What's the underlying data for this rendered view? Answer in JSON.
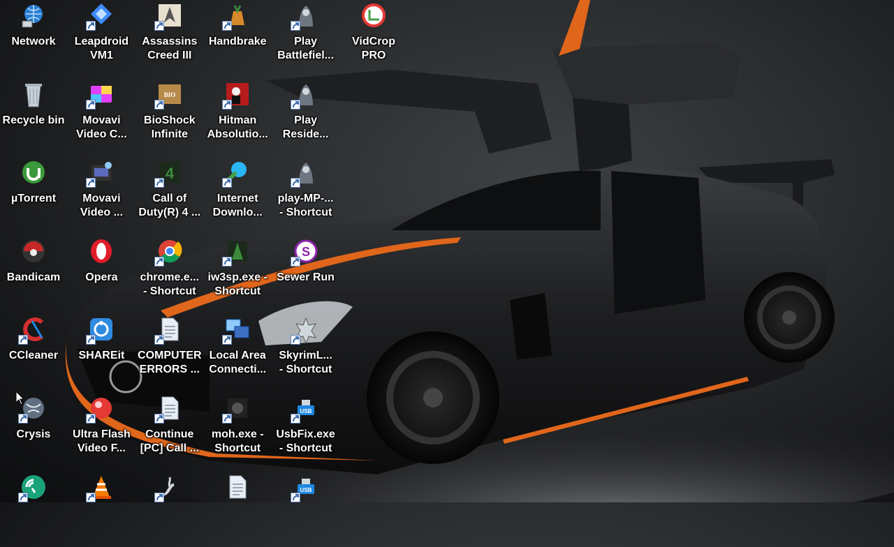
{
  "desktop": {
    "icons": [
      {
        "label": "Network",
        "icon": "network-icon",
        "shortcut": false,
        "color": "#2a7fd4"
      },
      {
        "label": "Recycle bin",
        "icon": "recycle-bin-icon",
        "shortcut": false,
        "color": "#9aa4ad"
      },
      {
        "label": "µTorrent",
        "icon": "utorrent-icon",
        "shortcut": false,
        "color": "#3a9a3a"
      },
      {
        "label": "Bandicam",
        "icon": "bandicam-icon",
        "shortcut": false,
        "color": "#c62828"
      },
      {
        "label": "CCleaner",
        "icon": "ccleaner-icon",
        "shortcut": true,
        "color": "#d32f2f"
      },
      {
        "label": "Crysis",
        "icon": "crysis-icon",
        "shortcut": true,
        "color": "#8fa0b0"
      },
      {
        "label": "",
        "icon": "audio-app-icon",
        "shortcut": true,
        "color": "#1aa37a"
      },
      {
        "label": "Leapdroid\nVM1",
        "icon": "leapdroid-icon",
        "shortcut": true,
        "color": "#3d8bfd"
      },
      {
        "label": "Movavi\nVideo C...",
        "icon": "movavi-converter-icon",
        "shortcut": true,
        "color": "#e040fb"
      },
      {
        "label": "Movavi\nVideo ...",
        "icon": "movavi-editor-icon",
        "shortcut": true,
        "color": "#5c6bc0"
      },
      {
        "label": "Opera",
        "icon": "opera-icon",
        "shortcut": false,
        "color": "#e11d2a"
      },
      {
        "label": "SHAREit",
        "icon": "shareit-icon",
        "shortcut": true,
        "color": "#2f8be0"
      },
      {
        "label": "Ultra Flash\nVideo F...",
        "icon": "ultra-flash-icon",
        "shortcut": true,
        "color": "#e53935"
      },
      {
        "label": "",
        "icon": "vlc-icon",
        "shortcut": true,
        "color": "#f57c00"
      },
      {
        "label": "Assassins\nCreed III",
        "icon": "assassins-creed-icon",
        "shortcut": true,
        "color": "#c9b48a"
      },
      {
        "label": "BioShock\nInfinite",
        "icon": "bioshock-icon",
        "shortcut": true,
        "color": "#b88a4a"
      },
      {
        "label": "Call of\nDuty(R) 4 ...",
        "icon": "call-of-duty-icon",
        "shortcut": true,
        "color": "#3c8a3c"
      },
      {
        "label": "chrome.e...\n- Shortcut",
        "icon": "chrome-icon",
        "shortcut": true,
        "color": "#4caf50"
      },
      {
        "label": "COMPUTER\nERRORS ...",
        "icon": "document-icon",
        "shortcut": true,
        "color": "#e8eef5"
      },
      {
        "label": "Continue\n[PC] Call ...",
        "icon": "text-file-icon",
        "shortcut": true,
        "color": "#e8eef5"
      },
      {
        "label": "",
        "icon": "steam-icon",
        "shortcut": true,
        "color": "#d0d4d8"
      },
      {
        "label": "Handbrake",
        "icon": "handbrake-icon",
        "shortcut": true,
        "color": "#d8892b"
      },
      {
        "label": "Hitman\nAbsolutio...",
        "icon": "hitman-icon",
        "shortcut": true,
        "color": "#b71c1c"
      },
      {
        "label": "Internet\nDownlo...",
        "icon": "idm-icon",
        "shortcut": true,
        "color": "#43a047"
      },
      {
        "label": "iw3sp.exe -\nShortcut",
        "icon": "iw3sp-icon",
        "shortcut": true,
        "color": "#3c8a3c"
      },
      {
        "label": "Local Area\nConnecti...",
        "icon": "local-area-connection-icon",
        "shortcut": true,
        "color": "#3f6fc0"
      },
      {
        "label": "moh.exe -\nShortcut",
        "icon": "moh-icon",
        "shortcut": true,
        "color": "#555"
      },
      {
        "label": "",
        "icon": "file-icon",
        "shortcut": false,
        "color": "#e8eef5"
      },
      {
        "label": "Play\nBattlefiel...",
        "icon": "battlefield-icon",
        "shortcut": true,
        "color": "#6e7781"
      },
      {
        "label": "Play\nReside...",
        "icon": "resident-evil-icon",
        "shortcut": true,
        "color": "#6e7781"
      },
      {
        "label": "play-MP-...\n- Shortcut",
        "icon": "play-mp-icon",
        "shortcut": true,
        "color": "#6e7781"
      },
      {
        "label": "Sewer Run",
        "icon": "sewer-run-icon",
        "shortcut": true,
        "color": "#8e24aa"
      },
      {
        "label": "SkyrimL...\n- Shortcut",
        "icon": "skyrim-icon",
        "shortcut": true,
        "color": "#cfd8dc"
      },
      {
        "label": "UsbFix.exe\n- Shortcut",
        "icon": "usbfix-icon",
        "shortcut": true,
        "color": "#1e88e5"
      },
      {
        "label": "",
        "icon": "usbfix-icon",
        "shortcut": true,
        "color": "#1e88e5"
      },
      {
        "label": "VidCrop\nPRO",
        "icon": "vidcrop-icon",
        "shortcut": false,
        "color": "#e53935"
      }
    ]
  }
}
